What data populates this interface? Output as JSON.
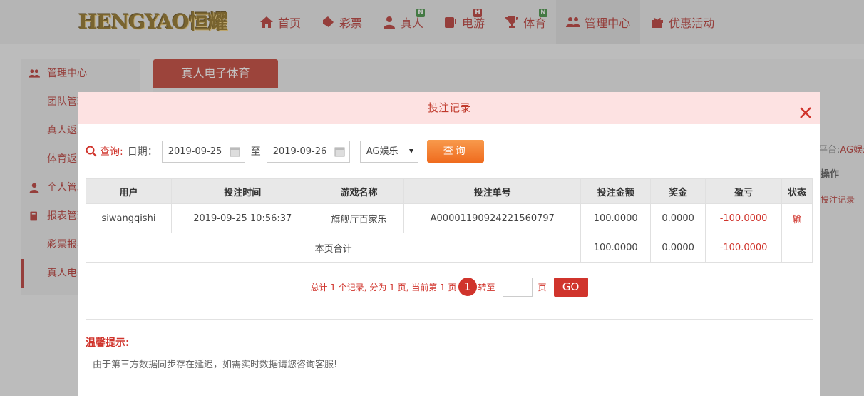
{
  "brand": {
    "logo_text": "HENGYAO恒耀"
  },
  "nav": {
    "items": [
      {
        "label": "首页",
        "icon": "home-icon"
      },
      {
        "label": "彩票",
        "icon": "ticket-icon"
      },
      {
        "label": "真人",
        "icon": "person-icon",
        "badge": "N"
      },
      {
        "label": "电游",
        "icon": "slot-machine-icon",
        "badge": "H"
      },
      {
        "label": "体育",
        "icon": "trophy-icon",
        "badge": "N"
      },
      {
        "label": "管理中心",
        "icon": "users-icon",
        "active": true
      },
      {
        "label": "优惠活动",
        "icon": "gift-icon"
      }
    ]
  },
  "sidebar": {
    "items": [
      {
        "label": "管理中心",
        "type": "head"
      },
      {
        "label": "团队管理",
        "type": "sub"
      },
      {
        "label": "真人返水",
        "type": "sub"
      },
      {
        "label": "体育返水",
        "type": "sub"
      },
      {
        "label": "个人管理",
        "type": "head"
      },
      {
        "label": "报表管理",
        "type": "head"
      },
      {
        "label": "彩票报表",
        "type": "sub"
      },
      {
        "label": "真人电子体育",
        "type": "sub",
        "current": true
      }
    ]
  },
  "main": {
    "tab_label": "真人电子体育",
    "platform_label": "平台:",
    "platform_value": "AG娱乐",
    "op_header": "操作",
    "op_link": "投注记录"
  },
  "modal": {
    "title": "投注记录",
    "query": {
      "label": "查询:",
      "date_label": "日期：",
      "date_from": "2019-09-25",
      "to_label": "至",
      "date_to": "2019-09-26",
      "platform_selected": "AG娱乐",
      "button": "查询"
    },
    "table": {
      "headers": [
        "用户",
        "投注时间",
        "游戏名称",
        "投注单号",
        "投注金额",
        "奖金",
        "盈亏",
        "状态"
      ],
      "rows": [
        {
          "user": "siwangqishi",
          "time": "2019-09-25 10:56:37",
          "game": "旗舰厅百家乐",
          "order_no": "A00001190924221560797",
          "amount": "100.0000",
          "bonus": "0.0000",
          "profit": "-100.0000",
          "status": "输"
        }
      ],
      "subtotal": {
        "label": "本页合计",
        "amount": "100.0000",
        "bonus": "0.0000",
        "profit": "-100.0000"
      }
    },
    "pager": {
      "summary": "总计 1 个记录, 分为 1 页, 当前第 1 页",
      "current_page": "1",
      "goto_label": "转至",
      "page_unit": "页",
      "go_button": "GO"
    },
    "tip": {
      "title": "温馨提示:",
      "text": "由于第三方数据同步存在延迟，如需实时数据请您咨询客服!"
    }
  },
  "colors": {
    "accent": "#c0392b",
    "query_button": "#ef6b1e",
    "modal_header_bg": "#fde2e2"
  }
}
